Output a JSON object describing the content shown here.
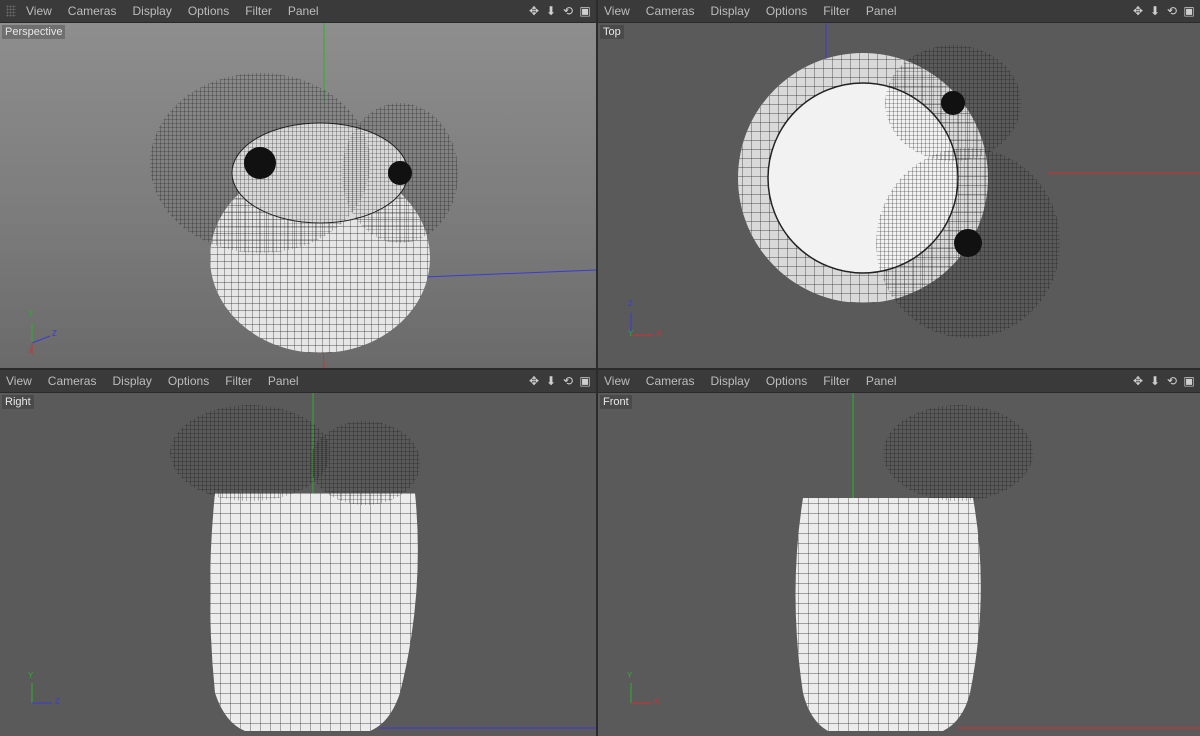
{
  "menu": [
    "View",
    "Cameras",
    "Display",
    "Options",
    "Filter",
    "Panel"
  ],
  "viewports": [
    {
      "id": "perspective",
      "label": "Perspective"
    },
    {
      "id": "top",
      "label": "Top"
    },
    {
      "id": "right",
      "label": "Right"
    },
    {
      "id": "front",
      "label": "Front"
    }
  ],
  "axes": {
    "x": "X",
    "y": "Y",
    "z": "Z"
  },
  "colors": {
    "x_axis": "#d23030",
    "y_axis": "#2fae2f",
    "z_axis": "#3a3ad6",
    "viewport_bg": "#5a5a5a",
    "menubar_bg": "#3a3a3a"
  },
  "icons": [
    "move-view-icon",
    "zoom-view-icon",
    "rotate-view-icon",
    "toggle-maximize-icon"
  ]
}
